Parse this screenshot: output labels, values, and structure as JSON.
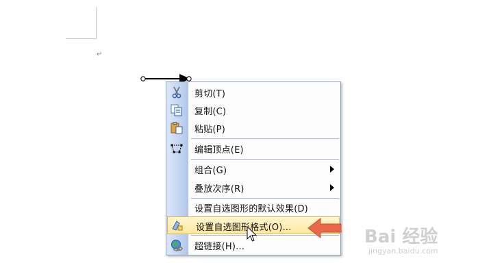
{
  "document": {
    "paragraph_mark": "↵"
  },
  "context_menu": {
    "items": [
      {
        "label": "剪切(T)",
        "icon": "scissors-icon"
      },
      {
        "label": "复制(C)",
        "icon": "copy-icon"
      },
      {
        "label": "粘贴(P)",
        "icon": "paste-icon"
      },
      {
        "label": "编辑顶点(E)",
        "icon": "edit-points-icon"
      },
      {
        "label": "组合(G)",
        "has_submenu": true
      },
      {
        "label": "叠放次序(R)",
        "has_submenu": true
      },
      {
        "label": "设置自选图形的默认效果(D)"
      },
      {
        "label": "设置自选图形格式(O)...",
        "icon": "format-shape-icon",
        "highlighted": true
      },
      {
        "label": "超链接(H)...",
        "icon": "hyperlink-icon"
      }
    ]
  },
  "watermark": {
    "logo": "Bai 经验",
    "url": "jingyan.baidu.com"
  },
  "colors": {
    "menu_border": "#8aa2c6",
    "gutter": "#c7d7f2",
    "highlight": "#ffe9a0",
    "annotation_arrow": "#e8694a"
  }
}
